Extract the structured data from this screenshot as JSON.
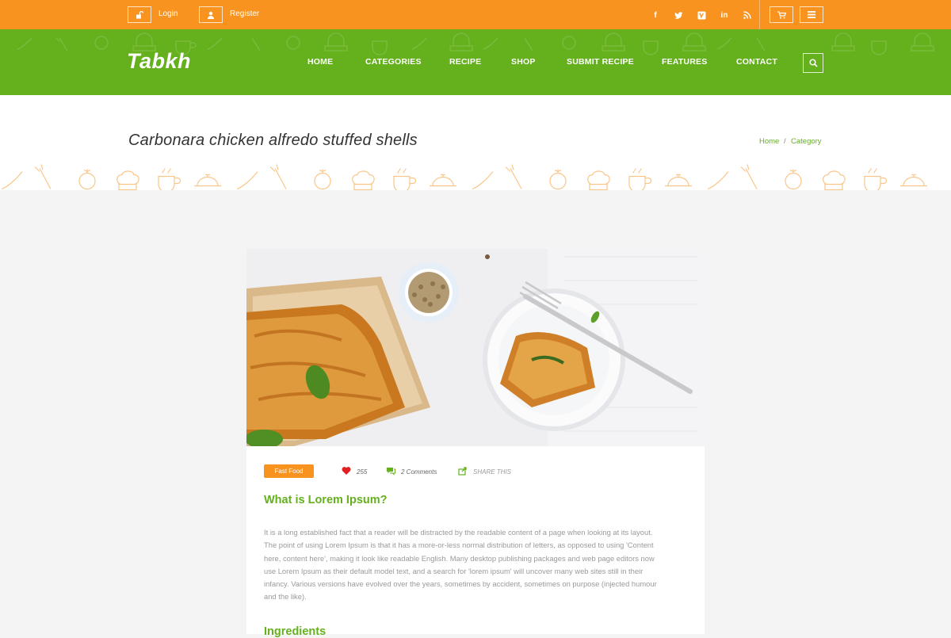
{
  "topbar": {
    "login_label": "Login",
    "register_label": "Register",
    "social_icons": [
      "facebook-icon",
      "twitter-icon",
      "vimeo-icon",
      "linkedin-icon",
      "rss-icon"
    ],
    "colors": {
      "bg": "#f7931e"
    }
  },
  "header": {
    "logo": "Tabkh",
    "nav": [
      {
        "label": "HOME"
      },
      {
        "label": "CATEGORIES"
      },
      {
        "label": "RECIPE"
      },
      {
        "label": "SHOP"
      },
      {
        "label": "SUBMIT RECIPE"
      },
      {
        "label": "FEATURES"
      },
      {
        "label": "CONTACT"
      }
    ],
    "colors": {
      "bg": "#64b01d"
    }
  },
  "page": {
    "title": "Carbonara chicken alfredo stuffed shells",
    "breadcrumb": {
      "home": "Home",
      "separator": "/",
      "current": "Category"
    }
  },
  "post": {
    "tag": "Fast Food",
    "likes": "255",
    "comments": "2 Comments",
    "share": "SHARE THIS",
    "heading": "What is Lorem Ipsum?",
    "body_lines": [
      "It is a long established fact that a reader will be distracted by the readable content of a page when looking at its layout.",
      "The point of using Lorem Ipsum is that it has a more-or-less normal distribution of letters, as opposed to using 'Content",
      "here, content here', making it look like readable English. Many desktop publishing packages and web page editors now",
      "use Lorem Ipsum as their default model text, and a search for 'lorem ipsum' will uncover many web sites still in their",
      "infancy. Various versions have evolved over the years, sometimes by accident, sometimes on purpose (injected humour",
      "and the like)."
    ],
    "subheading": "Ingredients",
    "colors": {
      "accent": "#64b01d",
      "tag": "#f7931e",
      "heart": "#e02020"
    }
  }
}
